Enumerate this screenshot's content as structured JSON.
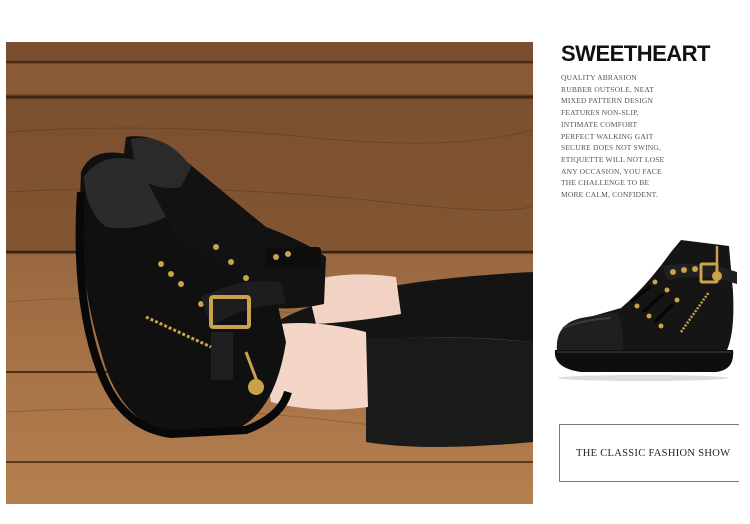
{
  "product": {
    "title": "SWEETHEART",
    "description_lines": [
      "QUALITY ABRASION",
      "RUBBER OUTSOLE, NEAT",
      "MIXED PATTERN DESIGN",
      "FEATURES NON-SLIP,",
      "INTIMATE COMFORT",
      "PERFECT WALKING GAIT",
      "SECURE DOES NOT SWING,",
      "ETIQUETTE WILL NOT LOSE",
      "ANY OCCASION, YOU FACE",
      "THE CHALLENGE TO BE",
      "MORE CALM, CONFIDENT."
    ],
    "footer_label": "THE CLASSIC FASHION SHOW"
  },
  "images": {
    "main_photo": "woman-wearing-black-high-top-sneakers-on-wood-floor",
    "thumbnail": "black-high-top-sneaker-side-view"
  },
  "colors": {
    "shoe_black": "#111111",
    "wood_dark": "#5a3a22",
    "wood_light": "#a8744a",
    "hardware_gold": "#c9a24a"
  }
}
